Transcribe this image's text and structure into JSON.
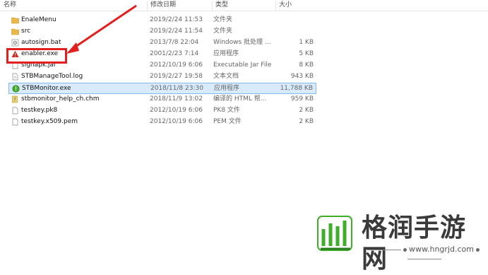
{
  "columns": {
    "name": "名称",
    "date": "修改日期",
    "type": "类型",
    "size": "大小"
  },
  "files": [
    {
      "icon": "folder-icon",
      "name": "EnaleMenu",
      "date": "2019/2/24 11:53",
      "type": "文件夹",
      "size": ""
    },
    {
      "icon": "folder-icon",
      "name": "src",
      "date": "2019/2/24 11:54",
      "type": "文件夹",
      "size": ""
    },
    {
      "icon": "batch-file-icon",
      "name": "autosign.bat",
      "date": "2013/7/8 22:04",
      "type": "Windows 批处理 ...",
      "size": "1 KB"
    },
    {
      "icon": "warning-icon",
      "name": "enabler.exe",
      "date": "2001/2/23 7:14",
      "type": "应用程序",
      "size": "5 KB"
    },
    {
      "icon": "jar-file-icon",
      "name": "signapk.jar",
      "date": "2012/10/19 6:06",
      "type": "Executable Jar File",
      "size": "8 KB"
    },
    {
      "icon": "document-icon",
      "name": "STBManageTool.log",
      "date": "2019/2/27 19:58",
      "type": "文本文档",
      "size": "943 KB"
    },
    {
      "icon": "app-icon",
      "name": "STBMonitor.exe",
      "date": "2018/11/8 23:30",
      "type": "应用程序",
      "size": "11,788 KB"
    },
    {
      "icon": "help-file-icon",
      "name": "stbmonitor_help_ch.chm",
      "date": "2018/11/9 13:02",
      "type": "编译的 HTML 帮...",
      "size": "959 KB"
    },
    {
      "icon": "document-icon",
      "name": "testkey.pk8",
      "date": "2012/10/19 6:06",
      "type": "PK8 文件",
      "size": "2 KB"
    },
    {
      "icon": "document-icon",
      "name": "testkey.x509.pem",
      "date": "2012/10/19 6:06",
      "type": "PEM 文件",
      "size": "2 KB"
    }
  ],
  "selected_file": "STBMonitor.exe",
  "annotation": {
    "color": "#e21f1f",
    "highlighted_file": "enabler.exe"
  },
  "watermark": {
    "title": "格润手游网",
    "url": "www.hngrjd.com",
    "logo_color": "#3fae2a"
  },
  "colors": {
    "selection_bg": "#d9ebfb",
    "selection_border": "#84b9e8",
    "folder": "#e8b84a"
  }
}
